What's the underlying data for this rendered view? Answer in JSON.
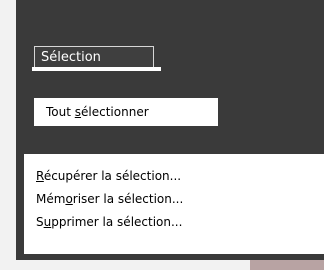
{
  "menu": {
    "title": "Sélection",
    "items": [
      {
        "pre": "Tout ",
        "accel": "s",
        "post": "électionner"
      },
      {
        "pre": "",
        "accel": "R",
        "post": "écupérer la sélection..."
      },
      {
        "pre": "Mém",
        "accel": "o",
        "post": "riser la sélection..."
      },
      {
        "pre": "S",
        "accel": "u",
        "post": "pprimer la sélection..."
      }
    ]
  }
}
